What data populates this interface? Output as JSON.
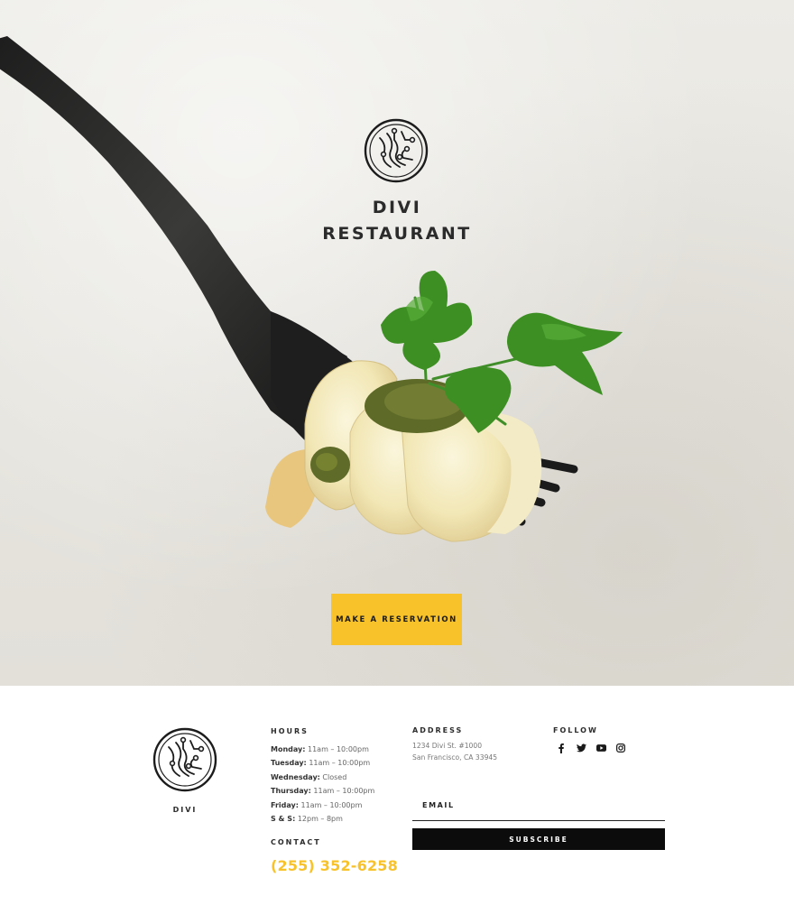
{
  "colors": {
    "accent": "#f8c22b",
    "dark": "#0c0c0c",
    "hero_bg": "#e8e6e0"
  },
  "hero": {
    "logo_icon": "circuit-circle-logo-icon",
    "title_line1": "DIVI",
    "title_line2": "RESTAURANT",
    "reservation_label": "MAKE A RESERVATION",
    "photo": "fork-with-pasta-pesto-parsley"
  },
  "footer": {
    "logo_icon": "circuit-circle-logo-icon",
    "brand": "DIVI",
    "hours": {
      "heading": "HOURS",
      "rows": [
        {
          "day": "Monday:",
          "time": "11am – 10:00pm"
        },
        {
          "day": "Tuesday:",
          "time": "11am – 10:00pm"
        },
        {
          "day": "Wednesday:",
          "time": "Closed"
        },
        {
          "day": "Thursday:",
          "time": "11am – 10:00pm"
        },
        {
          "day": "Friday:",
          "time": "11am – 10:00pm"
        },
        {
          "day": "S & S:",
          "time": "12pm – 8pm"
        }
      ]
    },
    "contact": {
      "heading": "CONTACT",
      "phone": "(255) 352-6258"
    },
    "address": {
      "heading": "ADDRESS",
      "line1": "1234 Divi St. #1000",
      "line2": "San Francisco, CA 33945"
    },
    "follow": {
      "heading": "FOLLOW",
      "icons": [
        "facebook-icon",
        "twitter-icon",
        "youtube-icon",
        "instagram-icon"
      ]
    },
    "newsletter": {
      "email_label": "EMAIL",
      "subscribe_label": "SUBSCRIBE"
    }
  }
}
